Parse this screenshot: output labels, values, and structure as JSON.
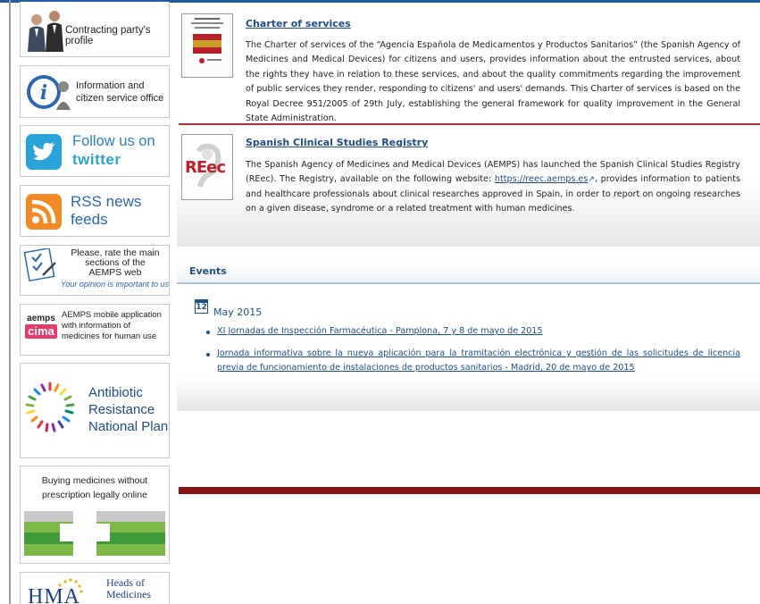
{
  "sidebar": {
    "contracting": "Contracting party's profile",
    "info_office": "Information and citizen service office",
    "twitter_line1": "Follow us on",
    "twitter_line2": "twitter",
    "rss_line1": "RSS news",
    "rss_line2": "feeds",
    "rate_line1": "Please, rate the main",
    "rate_line2": "sections of the",
    "rate_line3": "AEMPS web",
    "rate_line4": "Your opinion is important to us",
    "cima_logo_top": "aemps",
    "cima_logo_bottom": "cima",
    "cima_text": "AEMPS mobile application with information of medicines for human use",
    "antibiotic_line1": "Antibiotic",
    "antibiotic_line2": "Resistance",
    "antibiotic_line3": "National Plan",
    "buying_line1": "Buying medicines without",
    "buying_line2": "prescription legally online",
    "hma_logo": "HMA",
    "hma_line1": "Heads of",
    "hma_line2": "Medicines"
  },
  "articles": [
    {
      "title": "Charter of services",
      "body": "The Charter of services of the “Agencia Española de Medicamentos y Productos Sanitarios” (the Spanish Agency of Medicines and Medical Devices) for citizens and users, provides information about the entrusted services, about the rights they have in relation to these services, and about the quality commitments regarding the improvement of public services they render, responding to citizens' and users' demands. This Charter of services is based on the Royal Decree 951/2005 of 29th July, establishing the general framework for quality improvement in the General State Administration."
    },
    {
      "title": "Spanish Clinical Studies Registry",
      "logo_text": "REec",
      "body_before": "The Spanish Agency of Medicines and Medical Devices (AEMPS) has launched the Spanish Clinical Studies Registry (REec). The Registry, available on the following website: ",
      "link": "https://reec.aemps.es",
      "body_after": ", provides information to patients and healthcare professionals about clinical researches approved in Spain, in order to report on ongoing researches on a given disease, syndrome or a related treatment with human medicines."
    }
  ],
  "events": {
    "title": "Events",
    "calendar_day": "12",
    "month": "May 2015",
    "items": [
      "XI Jornadas de Inspección Farmacéutica - Pamplona, 7 y 8 de mayo de 2015",
      "Jornada informativa sobre la nueva aplicación para la tramitación electrónica y gestión de las solicitudes de licencia previa de funcionamiento de instalaciones de productos sanitarios - Madrid, 20 de mayo de 2015"
    ]
  },
  "colors": {
    "link_blue": "#1b4e86",
    "rule_red": "#b53333",
    "dark_bar": "#8b1414",
    "twitter_blue": "#2aa3d9",
    "rss_orange": "#f08a24"
  }
}
